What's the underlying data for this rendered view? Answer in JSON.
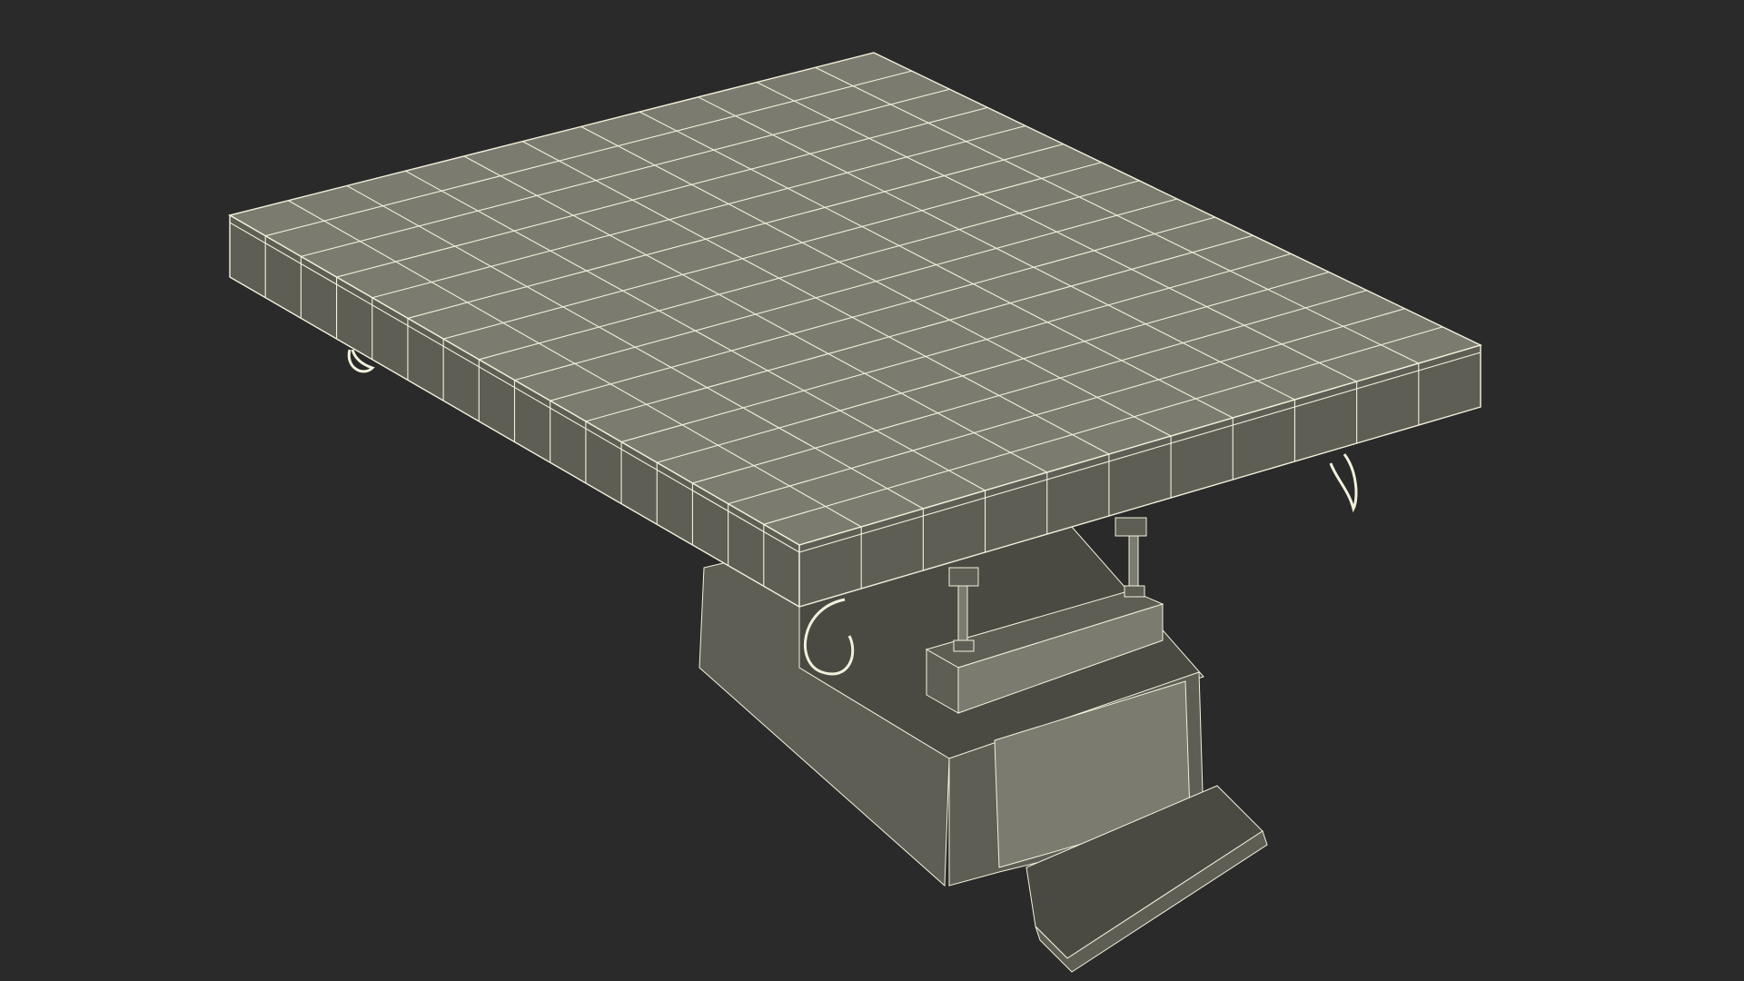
{
  "viewport": {
    "background": "#2a2a2a",
    "render_mode": "wireframe-on-shaded"
  },
  "model": {
    "subject": "table-top-on-pedestal",
    "surface_color": "#7b7b6f",
    "surface_shadow_color": "#5e5e55",
    "surface_dark_color": "#4a4a43",
    "wire_color": "#f3f1dc"
  }
}
